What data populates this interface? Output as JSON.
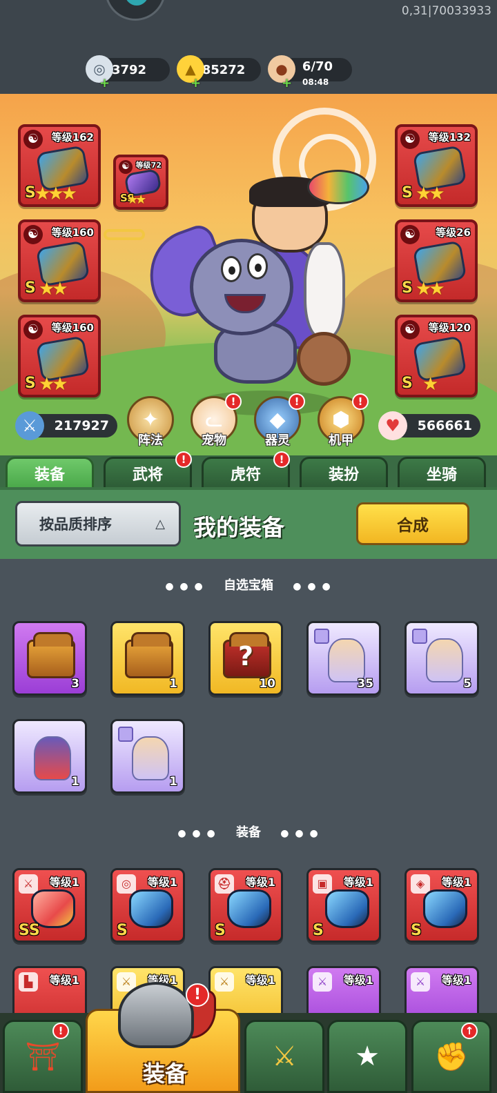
{
  "header": {
    "version": "0,31|70033933",
    "resources": {
      "silver": {
        "value": "3792",
        "icon": "silver-coin-icon"
      },
      "gold": {
        "value": "85272",
        "icon": "gold-ingot-icon"
      },
      "stamina": {
        "value": "6/70",
        "timer": "08:48",
        "icon": "meat-icon"
      }
    }
  },
  "hero": {
    "left_equipment": [
      {
        "level": "等级162",
        "grade": "S",
        "stars": "★★★"
      },
      {
        "level": "等级160",
        "grade": "S",
        "stars": "★★"
      },
      {
        "level": "等级160",
        "grade": "S",
        "stars": "★★"
      }
    ],
    "linked_item": {
      "level": "等级72",
      "grade": "SS",
      "stars": "★★"
    },
    "right_equipment": [
      {
        "level": "等级132",
        "grade": "S",
        "stars": "★★"
      },
      {
        "level": "等级26",
        "grade": "S",
        "stars": "★★"
      },
      {
        "level": "等级120",
        "grade": "S",
        "stars": "★"
      }
    ],
    "attack": "217927",
    "hp": "566661",
    "functions": [
      {
        "label": "阵法",
        "icon": "compass-icon",
        "badge": false
      },
      {
        "label": "宠物",
        "icon": "cat-icon",
        "badge": true
      },
      {
        "label": "器灵",
        "icon": "spirit-icon",
        "badge": true
      },
      {
        "label": "机甲",
        "icon": "mecha-icon",
        "badge": true
      }
    ]
  },
  "tabs": [
    {
      "label": "装备",
      "active": true,
      "badge": false
    },
    {
      "label": "武将",
      "active": false,
      "badge": true
    },
    {
      "label": "虎符",
      "active": false,
      "badge": true
    },
    {
      "label": "装扮",
      "active": false,
      "badge": false
    },
    {
      "label": "坐骑",
      "active": false,
      "badge": false
    }
  ],
  "toolbar": {
    "sort_label": "按品质排序",
    "sort_arrow": "△",
    "title": "我的装备",
    "merge_label": "合成"
  },
  "chest_section": {
    "title": "自选宝箱",
    "items": [
      {
        "count": "3",
        "type": "chest",
        "color": "purple"
      },
      {
        "count": "1",
        "type": "chest",
        "color": "gold"
      },
      {
        "count": "10",
        "type": "mystery-chest",
        "color": "gold"
      },
      {
        "count": "35",
        "type": "fragment",
        "color": "lilac"
      },
      {
        "count": "5",
        "type": "fragment",
        "color": "lilac"
      },
      {
        "count": "1",
        "type": "hero-card",
        "color": "lilac"
      },
      {
        "count": "1",
        "type": "fragment",
        "color": "lilac"
      }
    ]
  },
  "equipment_section": {
    "title": "装备",
    "items": [
      {
        "level": "等级1",
        "grade": "SS",
        "slot": "weapon",
        "color": "red"
      },
      {
        "level": "等级1",
        "grade": "S",
        "slot": "necklace",
        "color": "red"
      },
      {
        "level": "等级1",
        "grade": "S",
        "slot": "helmet",
        "color": "red"
      },
      {
        "level": "等级1",
        "grade": "S",
        "slot": "armor",
        "color": "red"
      },
      {
        "level": "等级1",
        "grade": "S",
        "slot": "ring",
        "color": "red"
      },
      {
        "level": "等级1",
        "grade": "",
        "slot": "boots",
        "color": "red"
      },
      {
        "level": "等级1",
        "grade": "",
        "slot": "weapon",
        "color": "gold"
      },
      {
        "level": "等级1",
        "grade": "",
        "slot": "weapon",
        "color": "gold"
      },
      {
        "level": "等级1",
        "grade": "",
        "slot": "weapon",
        "color": "purple"
      },
      {
        "level": "等级1",
        "grade": "",
        "slot": "weapon",
        "color": "purple"
      }
    ]
  },
  "bottom_nav": {
    "active_label": "装备",
    "items": [
      "shop",
      "equipment",
      "battle",
      "hero",
      "upgrade"
    ]
  }
}
